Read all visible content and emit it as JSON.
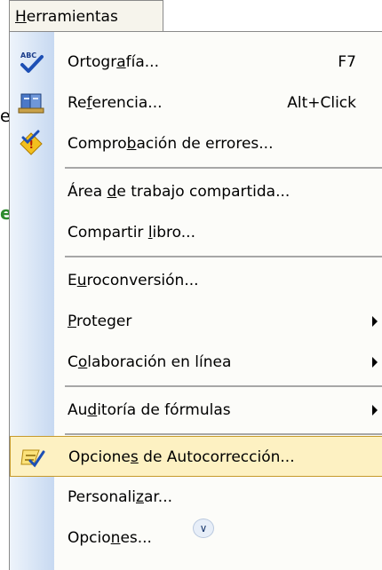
{
  "background": {
    "partial_text_1": "el",
    "partial_text_2": "e"
  },
  "menubar": {
    "title": "Herramientas"
  },
  "menu": {
    "items": [
      {
        "label": "Ortografía...",
        "shortcut": "F7",
        "icon": "spelling-abc-icon"
      },
      {
        "label": "Referencia...",
        "shortcut": "Alt+Click",
        "icon": "research-book-icon"
      },
      {
        "label": "Comprobación de errores...",
        "icon": "error-check-icon"
      },
      {
        "label": "Área de trabajo compartida..."
      },
      {
        "label": "Compartir libro..."
      },
      {
        "label": "Euroconversión..."
      },
      {
        "label": "Proteger",
        "submenu": true
      },
      {
        "label": "Colaboración en línea",
        "submenu": true
      },
      {
        "label": "Auditoría de fórmulas",
        "submenu": true
      },
      {
        "label": "Opciones de Autocorrección...",
        "icon": "autocorrect-icon",
        "highlighted": true
      },
      {
        "label": "Personalizar..."
      },
      {
        "label": "Opciones..."
      }
    ],
    "expand_icon": "double-chevron-down-icon"
  },
  "colors": {
    "highlight_bg": "#fdf1c2",
    "highlight_border": "#c69a2c",
    "gutter": "#c7d9f1",
    "accent_green": "#2e8b2e"
  }
}
